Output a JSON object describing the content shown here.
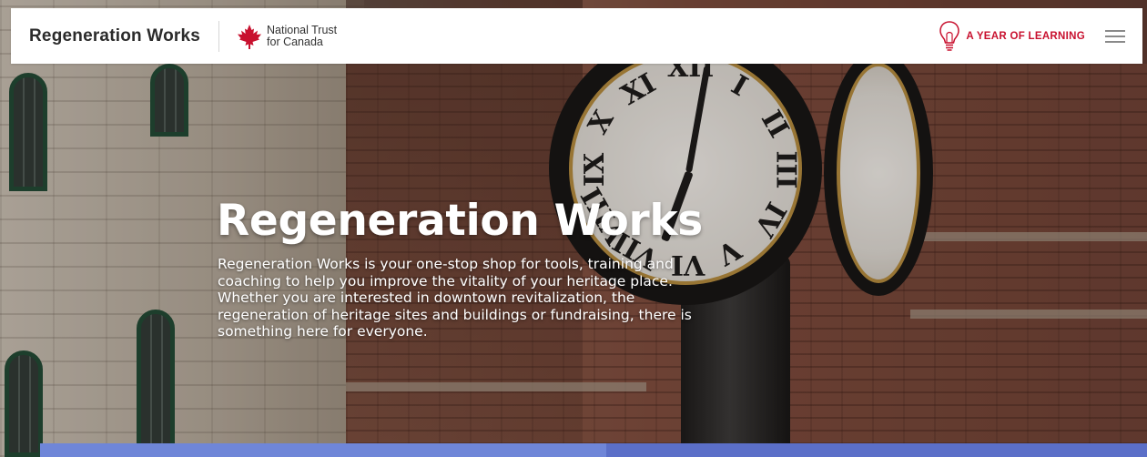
{
  "header": {
    "site_title": "Regeneration Works",
    "partner": {
      "line1": "National Trust",
      "line2": "for Canada",
      "icon": "maple-leaf-icon"
    },
    "year_of_learning": "A YEAR OF LEARNING",
    "bulb_icon": "lightbulb-icon",
    "menu_icon": "hamburger-menu-icon"
  },
  "hero": {
    "title": "Regeneration Works",
    "description": "Regeneration Works is your one-stop shop for tools, training and coaching to help you improve the vitality of your heritage place. Whether you are interested in downtown revitalization, the regeneration of heritage sites and buildings or fundraising, there is something here for everyone."
  },
  "colors": {
    "accent_red": "#c8102e",
    "strip_light": "#6f86d8",
    "strip_dark": "#5b6fc8"
  }
}
